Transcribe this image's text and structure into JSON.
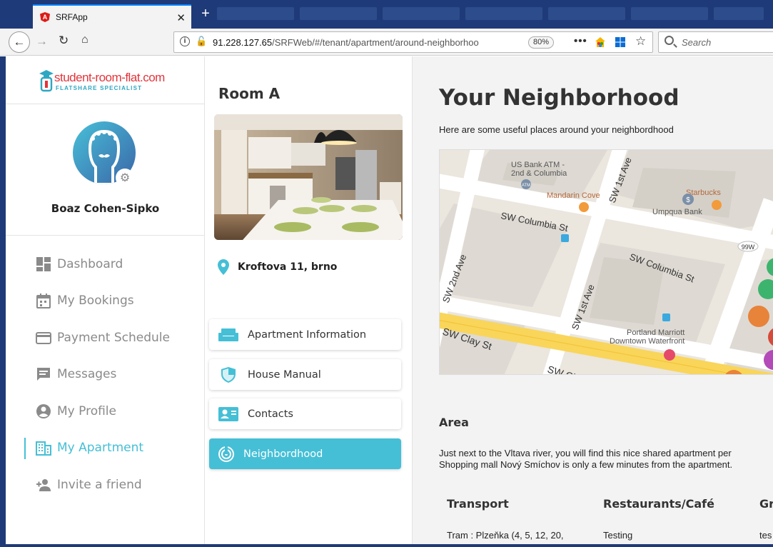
{
  "browser": {
    "tab_title": "SRFApp",
    "url_host": "91.228.127.65",
    "url_path": "/SRFWeb/#/tenant/apartment/around-neighborhoo",
    "zoom": "80%",
    "search_placeholder": "Search"
  },
  "brand": {
    "name": "student-room-flat.com",
    "tagline": "FLATSHARE SPECIALIST",
    "color": "#45bfd6"
  },
  "user": {
    "name": "Boaz Cohen-Sipko"
  },
  "sidebar": {
    "items": [
      {
        "label": "Dashboard",
        "icon": "dashboard-icon",
        "active": false
      },
      {
        "label": "My Bookings",
        "icon": "calendar-icon",
        "active": false
      },
      {
        "label": "Payment Schedule",
        "icon": "credit-card-icon",
        "active": false
      },
      {
        "label": "Messages",
        "icon": "message-icon",
        "active": false
      },
      {
        "label": "My Profile",
        "icon": "user-icon",
        "active": false
      },
      {
        "label": "My Apartment",
        "icon": "building-icon",
        "active": true
      },
      {
        "label": "Invite a friend",
        "icon": "add-person-icon",
        "active": false
      }
    ]
  },
  "room": {
    "title": "Room A",
    "address": "Kroftova 11, brno"
  },
  "apartment_menu": {
    "items": [
      {
        "label": "Apartment Information",
        "icon": "sofa-icon",
        "active": false
      },
      {
        "label": "House Manual",
        "icon": "shield-icon",
        "active": false
      },
      {
        "label": "Contacts",
        "icon": "contact-card-icon",
        "active": false
      },
      {
        "label": "Neighbordhood",
        "icon": "radar-icon",
        "active": true
      }
    ]
  },
  "main": {
    "title": "Your Neighborhood",
    "subtitle": "Here are some useful places around your neighbordhood",
    "map_labels": {
      "bank_atm": "US Bank ATM -",
      "bank_atm_2": "2nd & Columbia",
      "mandarin": "Mandarin Cove",
      "starbucks": "Starbucks",
      "umpqua": "Umpqua Bank",
      "columbia_1": "SW Columbia St",
      "columbia_2": "SW Columbia St",
      "second_ave": "SW 2nd Ave",
      "first_ave_1": "SW 1st Ave",
      "first_ave_2": "SW 1st Ave",
      "clay": "SW Clay St",
      "clay_2": "SW Cl",
      "marriott": "Portland Marriott",
      "marriott_2": "Downtown Waterfront",
      "route": "99W",
      "atm": "ATM"
    },
    "area_title": "Area",
    "area_text_1": "Just next to the Vltava river, you will find this nice shared apartment per",
    "area_text_2": "Shopping mall Nový Smíchov is only a few minutes from the apartment.",
    "columns": [
      {
        "header": "Transport",
        "value": "Tram : Plzeňka (4, 5, 12, 20,"
      },
      {
        "header": "Restaurants/Café",
        "value": "Testing"
      },
      {
        "header": "Gr",
        "value": "tes"
      }
    ]
  }
}
